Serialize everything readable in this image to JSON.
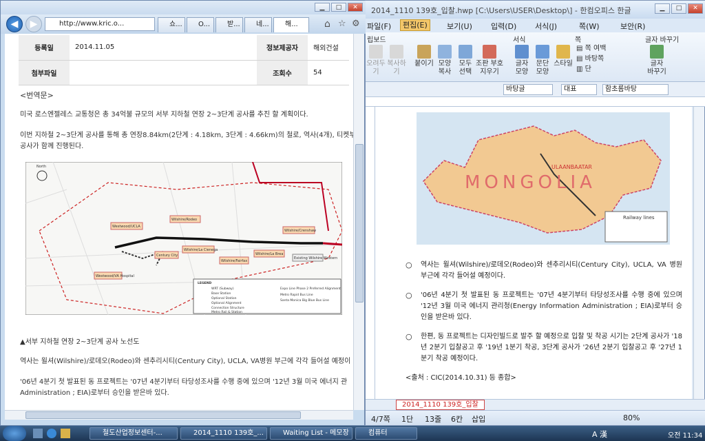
{
  "hwp": {
    "title": "2014_1110 139호_입찰.hwp [C:\\Users\\USER\\Desktop\\] - 한컴오피스 한글",
    "menus": [
      "파일(F)",
      "편집(E)",
      "보기(U)",
      "입력(D)",
      "서식(J)",
      "쪽(W)",
      "보안(R)"
    ],
    "ribbon_groups": [
      "립보드",
      "서식",
      "쪽",
      "글자 바꾸기"
    ],
    "ribbon_buttons": [
      "오려두기",
      "복사하기",
      "붙이기",
      "모양 복사",
      "모두 선택",
      "조판 부호 지우기",
      "글자 모양",
      "문단 모양",
      "스타일",
      "쪽 여백",
      "바탕쪽",
      "단",
      "글자 바꾸기"
    ],
    "combo_style": "바탕글",
    "combo_lang": "대표",
    "combo_font": "함초롬바탕",
    "map_label": "MONGOLIA",
    "map_city": "ULAANBAATAR",
    "legend_title": "Railway lines",
    "bullets": [
      "역사는 윌셔(Wilshire)/로데오(Rodeo)와 센추리시티(Century City), UCLA, VA 병원 부근에 각각 들어설 예정이다.",
      "'06년 4분기 첫 발표된 동 프로젝트는 '07년 4분기부터 타당성조사를 수행 중에 있으며 '12년 3월 미국 에너지 관리청(Energy Information Administration ; EIA)로부터 승인을 받은바 있다.",
      "한편, 동 프로젝트는 디자인빌드로 발주 할 예정으로 입찰 및 착공 시기는 2단계 공사가 '18년 2분기 입찰공고 후 '19년 1분기 착공, 3단계 공사가 '26년 2분기 입찰공고 후 '27년 1분기 착공 예정이다."
    ],
    "source": "<출처 : CIC(2014.10.31) 등 종합>",
    "doc_tab": "2014_1110 139호_입찰",
    "status": {
      "page": "4/7쪽",
      "col": "1단",
      "line": "13줄",
      "chars": "6칸",
      "mode": "삽입",
      "zoom": "80%"
    }
  },
  "ie": {
    "url": "http://www.kric.o...",
    "tabs": [
      "쇼...",
      "O...",
      "받...",
      "네...",
      "해..."
    ],
    "table": [
      {
        "label": "등록일",
        "value": "2014.11.05",
        "label2": "정보제공자",
        "value2": "해외건설"
      },
      {
        "label": "첨부파일",
        "value": "",
        "label2": "조회수",
        "value2": "54"
      }
    ],
    "section": "<번역문>",
    "p1": "미국 로스엔젤레스 교통청은 총 34억불 규모의 서부 지하철 연장 2~3단계 공사를 추진 할 계획이다.",
    "p2": "이번 지하철 2~3단계 공사를 통해 총 연장8.84km(2단계 : 4.18km, 3단계 : 4.66km)의 철로, 역사(4개), 티켓부스,",
    "p3": "공사가 함께 진행된다.",
    "map_north": "North",
    "stations": [
      "Westwood/UCLA",
      "Wilshire/Rodeo",
      "Wilshire/Crenshaw",
      "Century City",
      "Wilshire/La Cienega",
      "Wilshire/Fairfax",
      "Wilshire/La Brea",
      "Westwood/VA Hospital",
      "Existing Wilshire Western"
    ],
    "legend": {
      "title": "LEGEND",
      "items": [
        "WRT (Subway)",
        "Base Station",
        "Optional Station",
        "Optional Alignment",
        "Connection Structure",
        "Metro Rail & Station",
        "Expo Line Phase 2 Preferred Alignment",
        "Metro Rapid Bus Line",
        "Santa Monica Big Blue Bus Line"
      ]
    },
    "caption": "▲서부 지하철 연장 2~3단계 공사 노선도",
    "p4": "역사는 윌셔(Wilshire)/로데오(Rodeo)와 센추리시티(Century City), UCLA, VA병원 부근에 각각 들어설 예정이",
    "p5": "'06년 4분기 첫 발표된 동 프로젝트는 '07년 4분기부터 타당성조사를 수행 중에 있으며 '12년 3월 미국 에너지 관",
    "p6": "Administration ; EIA)로부터 승인을 받은바 있다."
  },
  "taskbar": {
    "items": [
      "철도산업정보센터-...",
      "2014_1110 139호_...",
      "Waiting List - 메모장",
      "컴퓨터"
    ],
    "time": "오전 11:34",
    "ime": "A 漢"
  },
  "colors": {
    "accent": "#f4c76a",
    "map_fill": "#f2c992",
    "route_red": "#cc2222",
    "doc_tab_red": "#cc1f1f"
  }
}
